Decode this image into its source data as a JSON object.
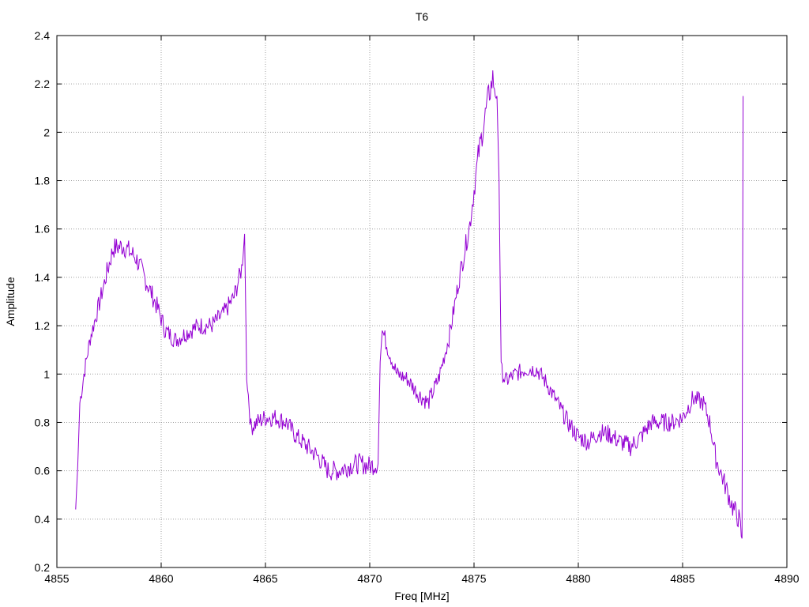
{
  "chart_data": {
    "type": "line",
    "title": "T6",
    "xlabel": "Freq [MHz]",
    "ylabel": "Amplitude",
    "xlim": [
      4855,
      4890
    ],
    "ylim": [
      0.2,
      2.4
    ],
    "xticks": [
      4855,
      4860,
      4865,
      4870,
      4875,
      4880,
      4885,
      4890
    ],
    "yticks": [
      0.2,
      0.4,
      0.6,
      0.8,
      1,
      1.2,
      1.4,
      1.6,
      1.8,
      2,
      2.2,
      2.4
    ],
    "grid": true,
    "legend": "none",
    "series": [
      {
        "color": "#9400d3",
        "noise": 0.035,
        "x": [
          4855.9,
          4856.0,
          4856.1,
          4856.3,
          4856.6,
          4857.0,
          4857.4,
          4857.7,
          4858.2,
          4858.8,
          4859.3,
          4859.8,
          4860.2,
          4860.7,
          4861.2,
          4861.8,
          4862.4,
          4863.0,
          4863.5,
          4863.9,
          4864.0,
          4864.1,
          4864.3,
          4864.6,
          4865.0,
          4865.5,
          4866.0,
          4866.5,
          4867.0,
          4867.5,
          4868.0,
          4868.5,
          4869.0,
          4869.5,
          4870.0,
          4870.4,
          4870.5,
          4870.6,
          4870.9,
          4871.3,
          4871.8,
          4872.3,
          4872.8,
          4873.3,
          4873.8,
          4874.3,
          4874.8,
          4875.2,
          4875.5,
          4875.7,
          4875.9,
          4876.1,
          4876.2,
          4876.3,
          4876.5,
          4877.0,
          4877.5,
          4878.0,
          4878.5,
          4879.0,
          4879.5,
          4880.0,
          4880.5,
          4881.0,
          4881.5,
          4882.0,
          4882.5,
          4883.0,
          4883.5,
          4884.0,
          4884.5,
          4885.0,
          4885.5,
          4886.0,
          4886.3,
          4886.6,
          4887.0,
          4887.4,
          4887.7,
          4887.85,
          4887.9
        ],
        "y": [
          0.44,
          0.62,
          0.88,
          1.0,
          1.15,
          1.28,
          1.42,
          1.52,
          1.53,
          1.48,
          1.38,
          1.28,
          1.18,
          1.14,
          1.17,
          1.2,
          1.2,
          1.25,
          1.32,
          1.45,
          1.58,
          1.0,
          0.78,
          0.8,
          0.82,
          0.82,
          0.8,
          0.74,
          0.7,
          0.66,
          0.6,
          0.6,
          0.62,
          0.63,
          0.62,
          0.63,
          1.05,
          1.18,
          1.1,
          1.0,
          0.98,
          0.92,
          0.88,
          0.98,
          1.15,
          1.4,
          1.62,
          1.9,
          2.05,
          2.15,
          2.22,
          2.15,
          1.8,
          1.02,
          0.97,
          1.0,
          1.02,
          1.02,
          0.96,
          0.88,
          0.8,
          0.74,
          0.72,
          0.76,
          0.75,
          0.72,
          0.7,
          0.74,
          0.8,
          0.8,
          0.8,
          0.82,
          0.9,
          0.88,
          0.8,
          0.65,
          0.55,
          0.45,
          0.4,
          0.32,
          2.15
        ]
      }
    ]
  }
}
